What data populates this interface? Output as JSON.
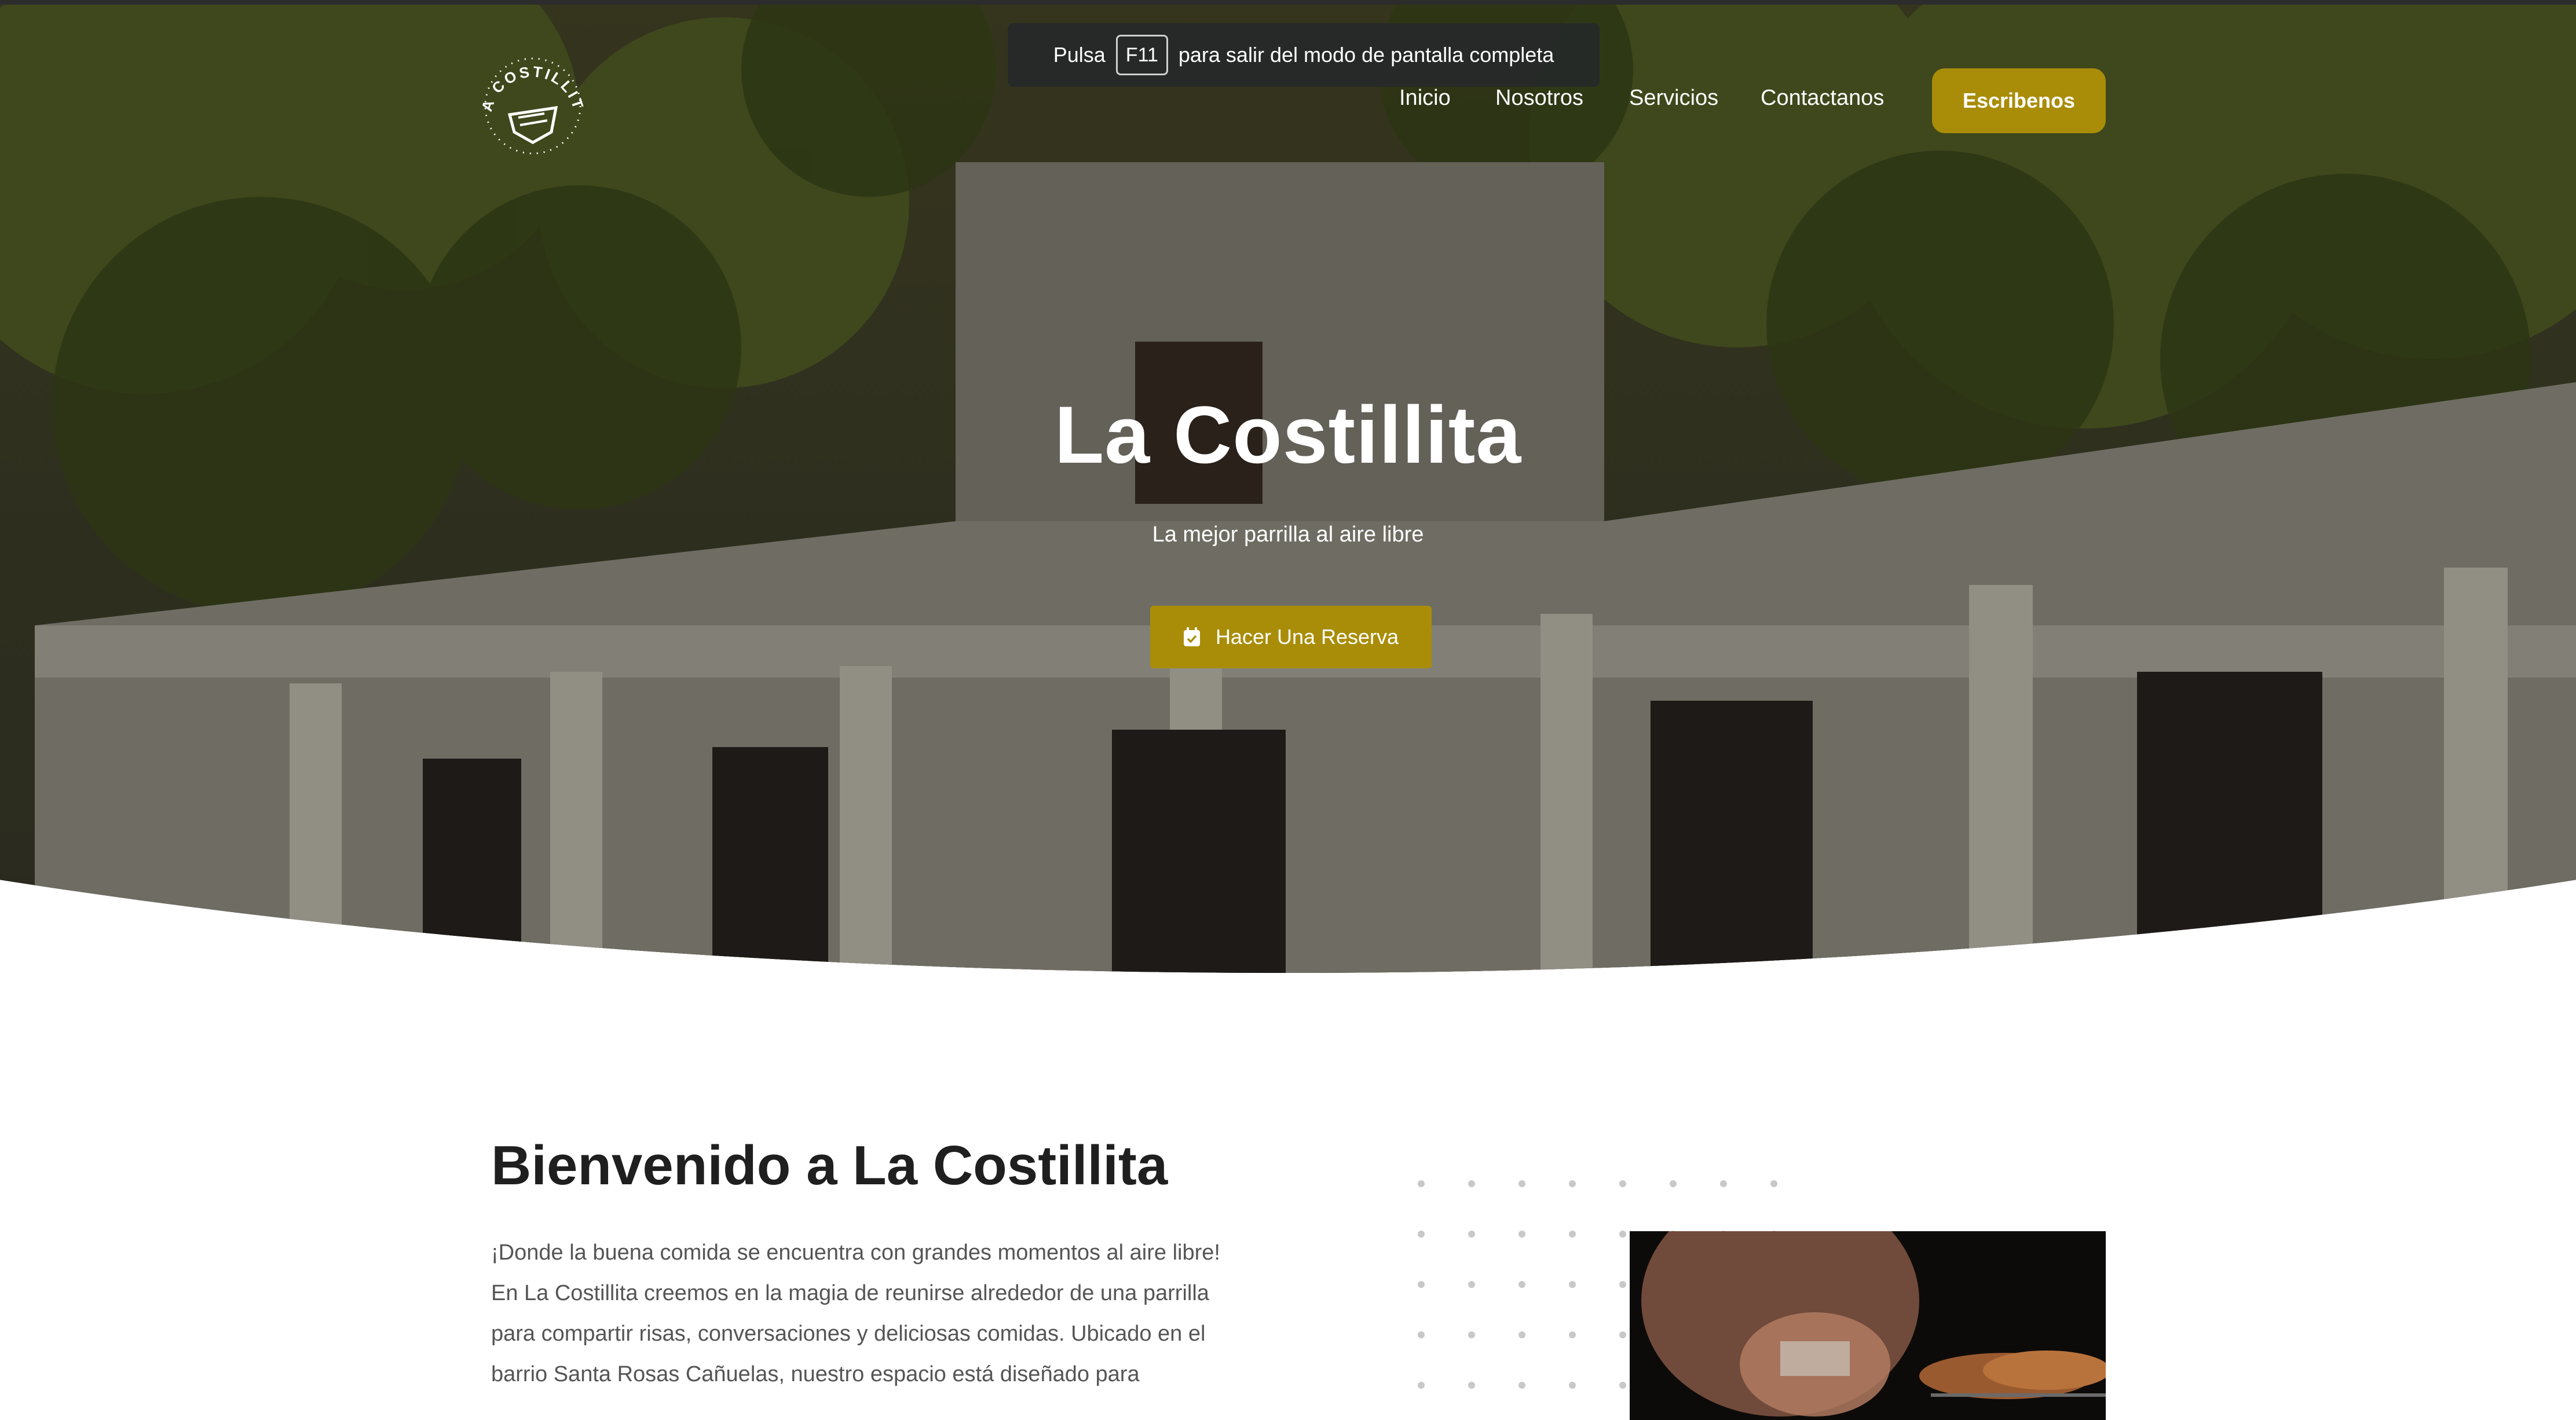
{
  "colors": {
    "accent": "#a98d08",
    "hero_overlay": "#3c3a2e",
    "heading": "#1f1f1f",
    "body_text": "#555555"
  },
  "fullscreen_notice": {
    "prefix": "Pulsa",
    "key": "F11",
    "suffix": "para salir del modo de pantalla completa"
  },
  "brand": {
    "logo_text": "LA COSTILLITA",
    "logo_icon": "grill-icon"
  },
  "nav": {
    "items": [
      "Inicio",
      "Nosotros",
      "Servicios",
      "Contactanos"
    ],
    "cta": "Escribenos"
  },
  "hero": {
    "title": "La Costillita",
    "subtitle": "La mejor parrilla al aire libre",
    "button_label": "Hacer Una Reserva",
    "button_icon": "calendar-icon"
  },
  "welcome": {
    "title": "Bienvenido a La Costillita",
    "paragraph_1": "¡Donde la buena comida se encuentra con grandes momentos al aire libre!",
    "paragraph_2": "En La Costillita creemos en la magia de reunirse alrededor de una parrilla para compartir risas, conversaciones y deliciosas comidas. Ubicado en el barrio Santa Rosas Cañuelas, nuestro espacio está diseñado para"
  }
}
